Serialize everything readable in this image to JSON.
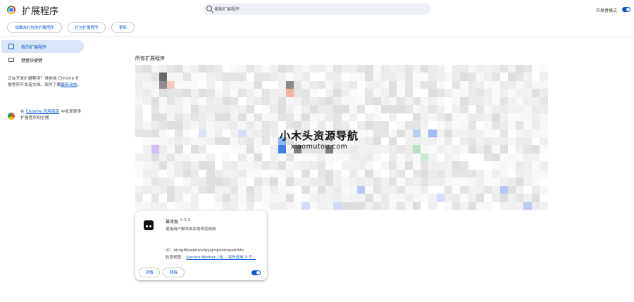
{
  "header": {
    "app_title": "扩展程序",
    "search_placeholder": "搜索扩展程序",
    "dev_mode_label": "开发者模式",
    "dev_mode_on": true
  },
  "toolbar": {
    "load_unpacked": "加载未打包的扩展程序",
    "pack": "打包扩展程序",
    "update": "更新"
  },
  "sidebar": {
    "items": [
      {
        "label": "我的扩展程序",
        "icon": "puzzle-icon",
        "active": true
      },
      {
        "label": "键盘快捷键",
        "icon": "keyboard-icon",
        "active": false
      }
    ],
    "dev_note_prefix": "正在开发扩展程序？请参阅 Chrome 扩展程序开发者文档。及时了解",
    "dev_note_link": "最新动态",
    "dev_note_suffix": "。",
    "store_prefix": "在",
    "store_link": "Chrome 应用商店",
    "store_suffix": "中发现更多扩展程序和主题"
  },
  "main": {
    "section_title": "所有扩展程序"
  },
  "watermark": {
    "title": "小木头资源导航",
    "subtitle": "xiaomutou.com"
  },
  "extension_card": {
    "name": "篡改猴",
    "version": "5.3.3",
    "description": "使用用户脚本自由地改变网络",
    "id_text": "ID：dhdgffkkebhmkfjojejmpbldmpobfkfo",
    "inspect_label": "检查视图：",
    "inspect_link": "Service Worker（无... 另外还有 3 个...",
    "details_button": "详情",
    "remove_button": "移除",
    "enabled": true
  }
}
